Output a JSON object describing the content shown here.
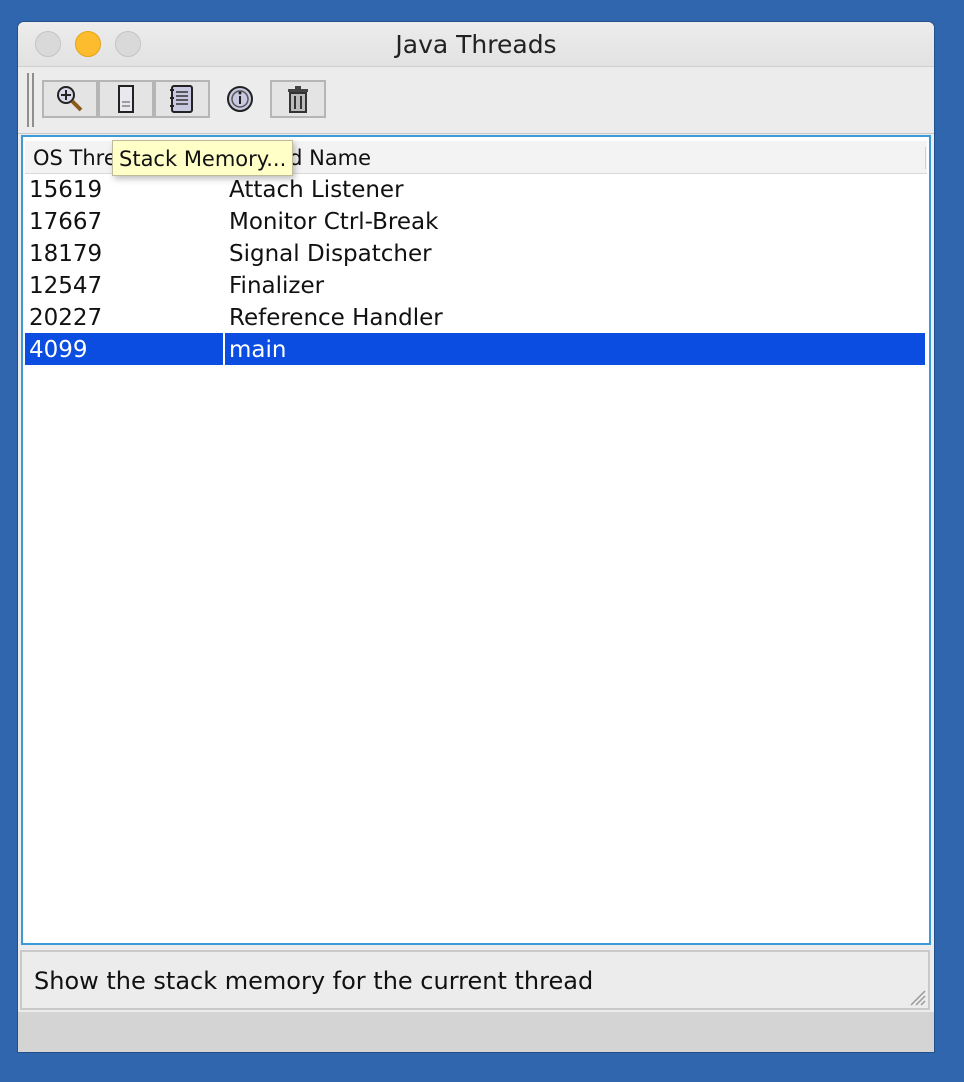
{
  "window": {
    "title": "Java Threads"
  },
  "toolbar": {
    "buttons": [
      {
        "name": "inspect-thread",
        "icon": "magnifier-icon"
      },
      {
        "name": "stack-memory",
        "icon": "stack-icon"
      },
      {
        "name": "show-stack-trace",
        "icon": "notepad-icon"
      },
      {
        "name": "thread-info",
        "icon": "info-icon"
      },
      {
        "name": "delete",
        "icon": "trash-icon"
      }
    ]
  },
  "table": {
    "columns": [
      "OS Thre",
      "Thread Name"
    ],
    "rows": [
      {
        "id": "15619",
        "name": "Attach Listener"
      },
      {
        "id": "17667",
        "name": "Monitor Ctrl-Break"
      },
      {
        "id": "18179",
        "name": "Signal Dispatcher"
      },
      {
        "id": "12547",
        "name": "Finalizer"
      },
      {
        "id": "20227",
        "name": "Reference Handler"
      },
      {
        "id": "4099",
        "name": "main"
      }
    ],
    "selected_row": "4099"
  },
  "tooltip": {
    "text": "Stack Memory..."
  },
  "status": {
    "text": "Show the stack memory for the current thread"
  },
  "colors": {
    "desktop": "#2f66ae",
    "selection": "#0a4de0",
    "focus_border": "#3c9ad8",
    "tooltip_bg": "#ffffc8",
    "minimize_button": "#fdbc2e"
  }
}
